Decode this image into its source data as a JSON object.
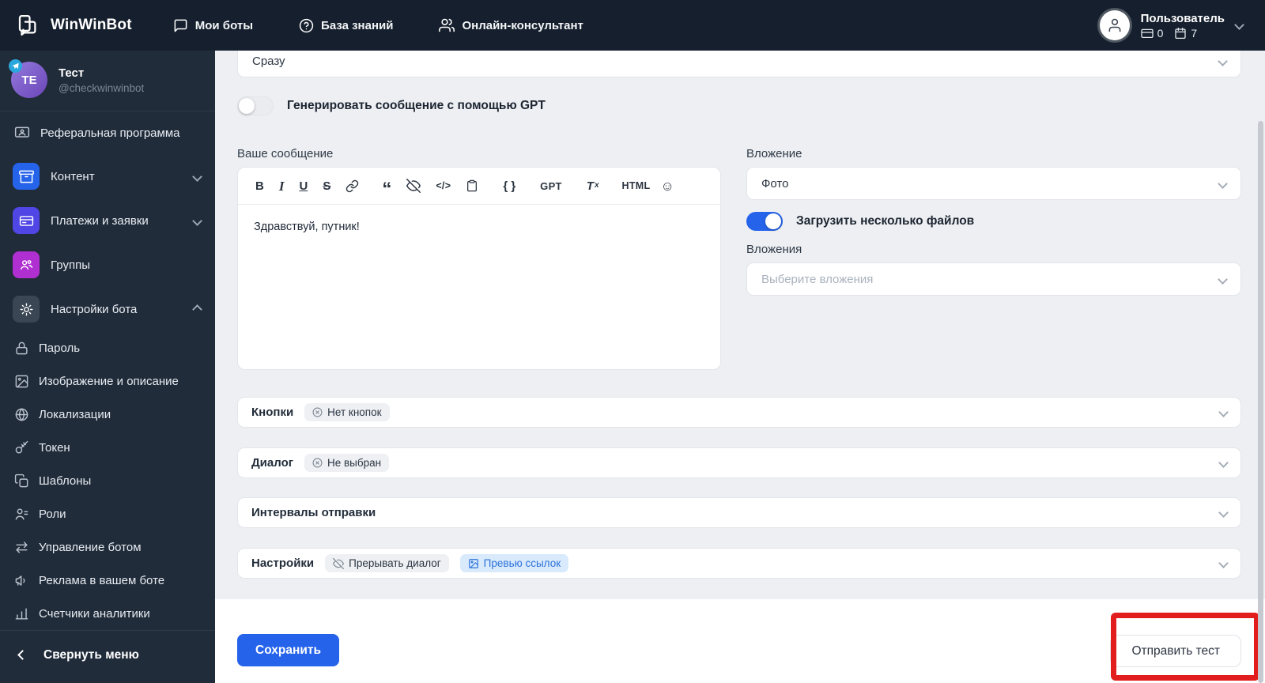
{
  "navbar": {
    "brand": "WinWinBot",
    "items": [
      {
        "label": "Мои боты"
      },
      {
        "label": "База знаний"
      },
      {
        "label": "Онлайн-консультант"
      }
    ],
    "user": {
      "name": "Пользователь",
      "card_count": "0",
      "calendar_count": "7"
    }
  },
  "sidebar": {
    "bot": {
      "initials": "TE",
      "name": "Тест",
      "handle": "@checkwinwinbot"
    },
    "referral_label": "Реферальная программа",
    "groups": [
      {
        "label": "Контент"
      },
      {
        "label": "Платежи и заявки"
      },
      {
        "label": "Группы"
      },
      {
        "label": "Настройки бота"
      }
    ],
    "settings_items": [
      "Пароль",
      "Изображение и описание",
      "Локализации",
      "Токен",
      "Шаблоны",
      "Роли",
      "Управление ботом",
      "Реклама в вашем боте",
      "Счетчики аналитики"
    ],
    "collapse_label": "Свернуть меню"
  },
  "main": {
    "send_when_value": "Сразу",
    "gpt_toggle_label": "Генерировать сообщение с помощью GPT",
    "message": {
      "label": "Ваше сообщение",
      "content": "Здравствуй, путник!",
      "toolbar": {
        "bold": "B",
        "italic": "I",
        "underline": "U",
        "strike": "S",
        "quote": "“",
        "code": "</>",
        "braces": "{ }",
        "gpt": "GPT",
        "clear_t": "T",
        "clear_x": "x",
        "html": "HTML",
        "emoji": "☺"
      }
    },
    "attachment": {
      "label": "Вложение",
      "type_value": "Фото",
      "multi_toggle_label": "Загрузить несколько файлов",
      "attachments_label": "Вложения",
      "attachments_placeholder": "Выберите вложения"
    },
    "accordions": [
      {
        "title": "Кнопки",
        "badges": [
          {
            "text": "Нет кнопок"
          }
        ]
      },
      {
        "title": "Диалог",
        "badges": [
          {
            "text": "Не выбран"
          }
        ]
      },
      {
        "title": "Интервалы отправки",
        "badges": []
      },
      {
        "title": "Настройки",
        "badges": [
          {
            "text": "Прерывать диалог"
          },
          {
            "text": "Превью ссылок"
          }
        ]
      }
    ],
    "footer": {
      "save_label": "Сохранить",
      "test_label": "Отправить тест"
    }
  },
  "colors": {
    "primary": "#2563eb",
    "navbar_bg": "#151f2d",
    "sidebar_bg": "#212c3a",
    "content_icon": "#2563eb",
    "payments_icon": "#4f46e5",
    "groups_icon": "#b02fd1",
    "settings_icon": "#3a4654",
    "badge_blue_bg": "#d8eafc",
    "annotation_red": "#e11d1d"
  }
}
